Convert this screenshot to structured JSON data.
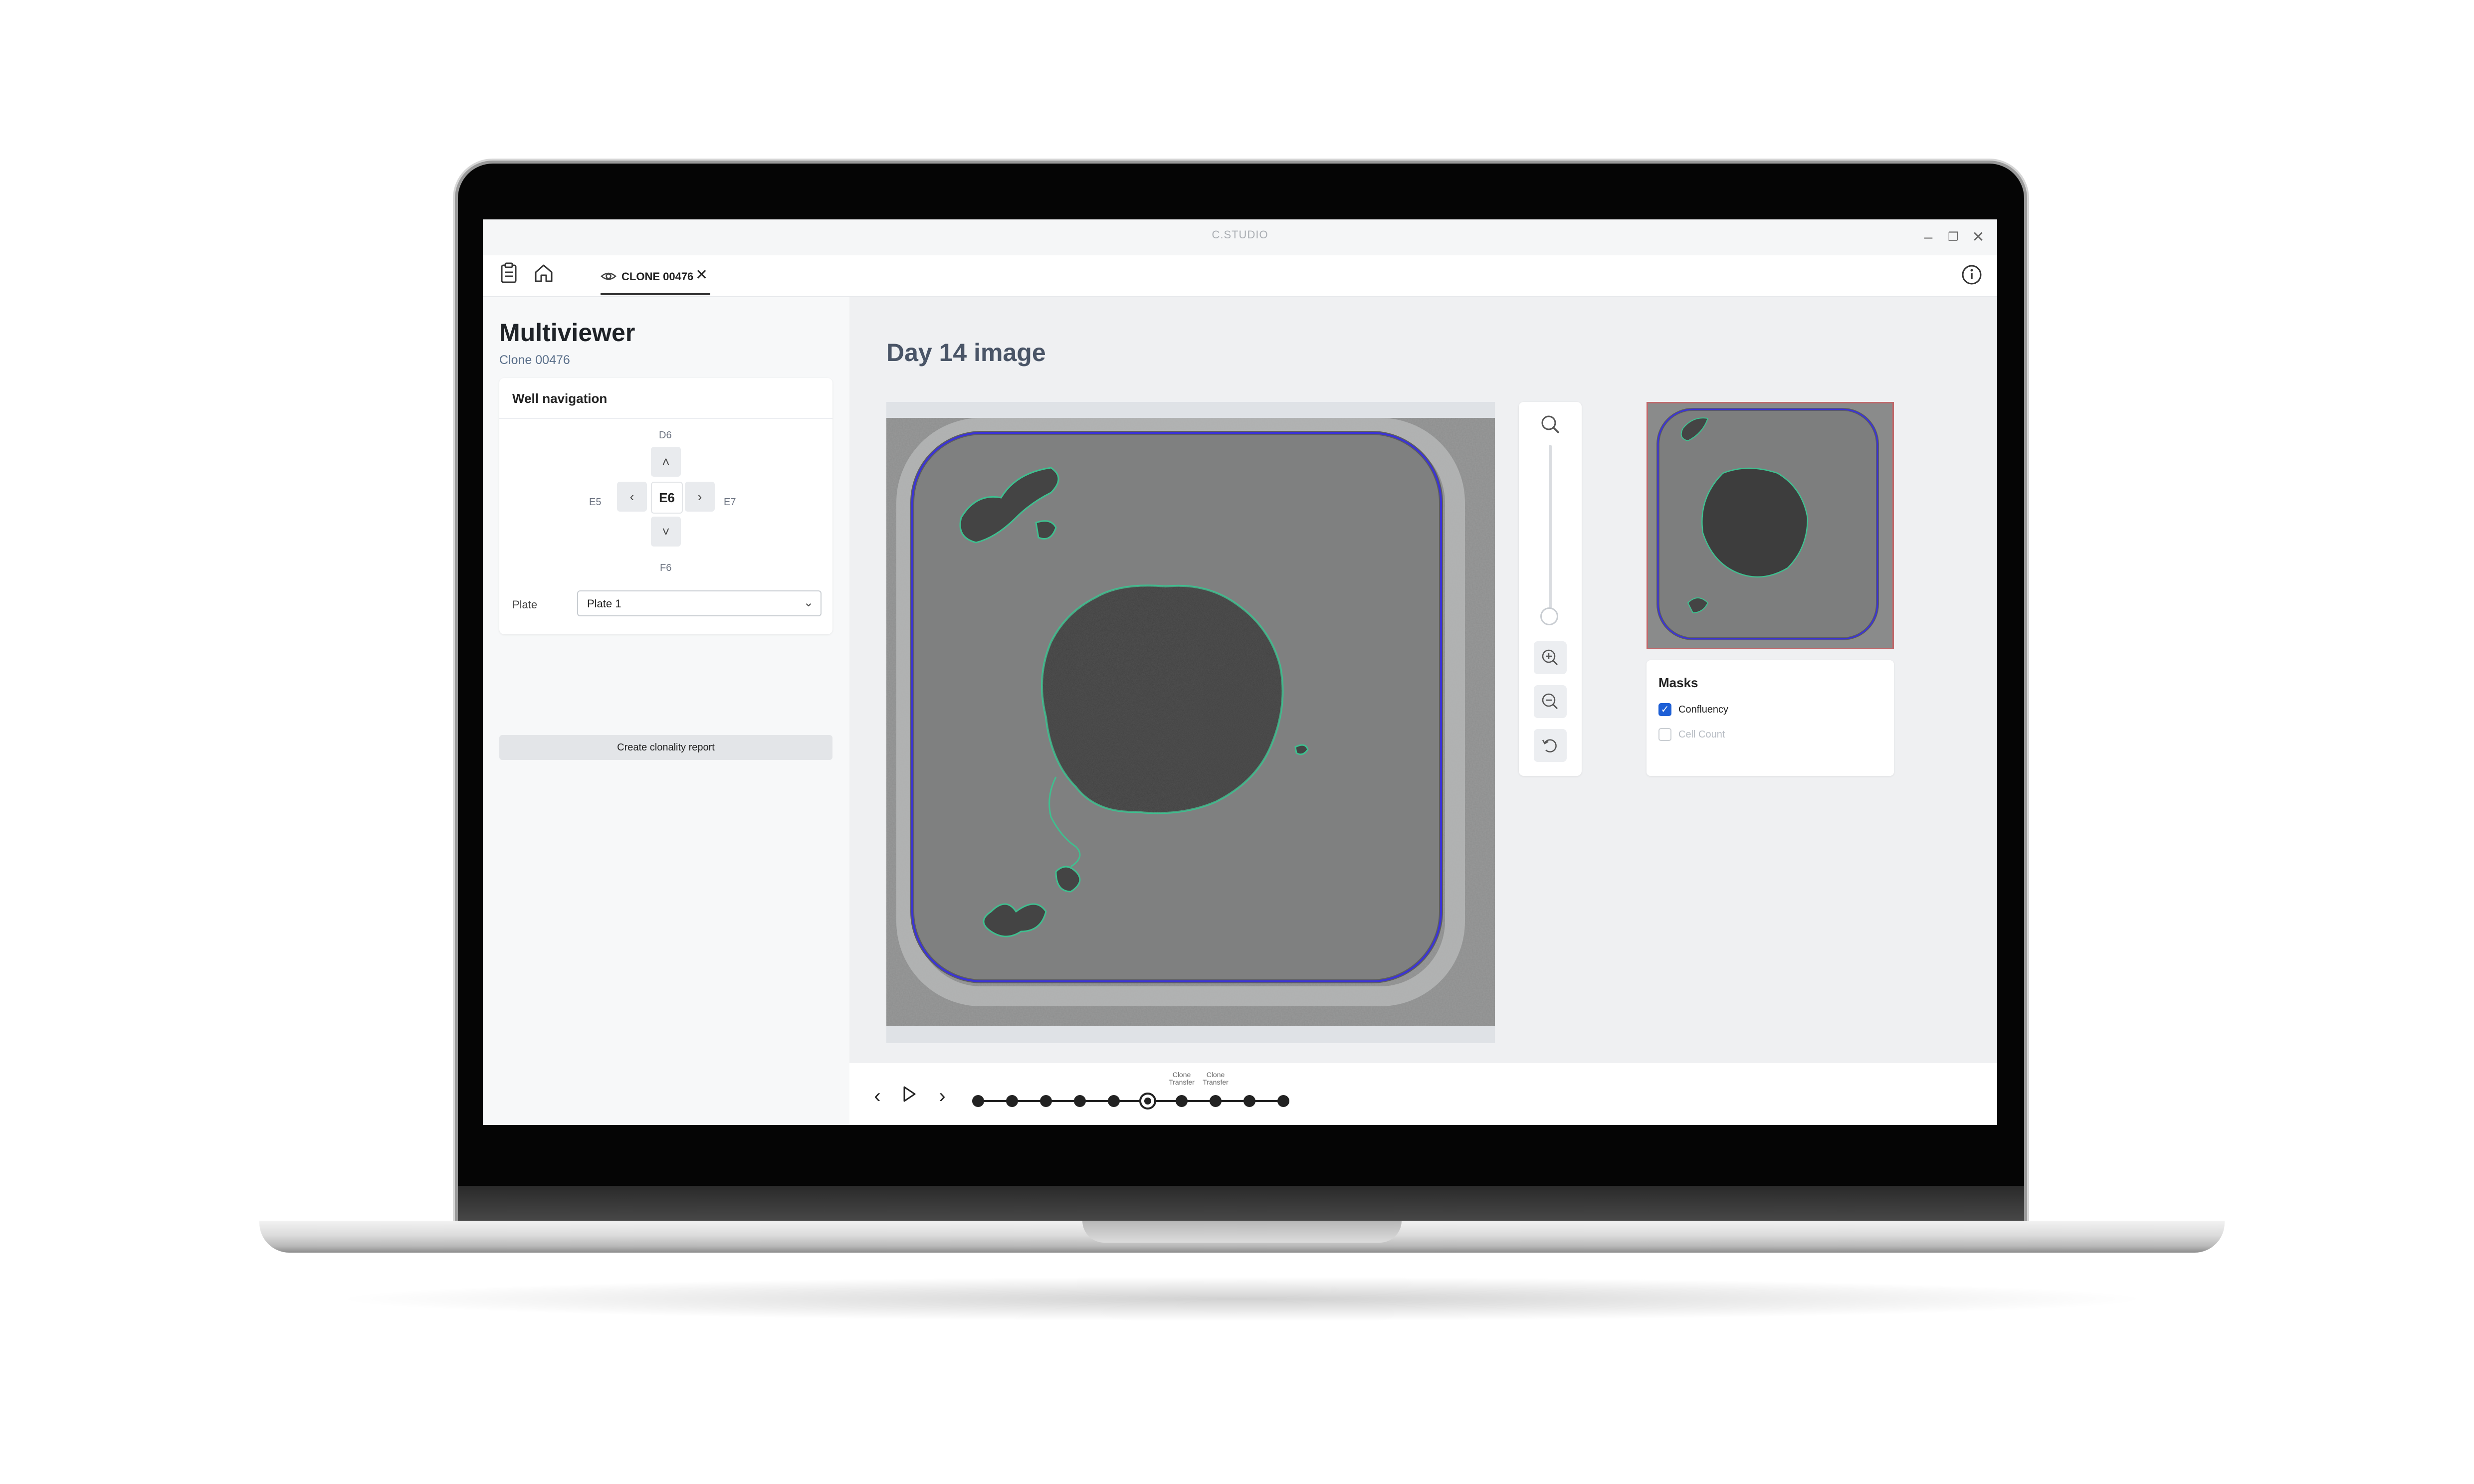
{
  "app": {
    "title": "C.STUDIO"
  },
  "window_controls": [
    "minimize",
    "restore",
    "close"
  ],
  "tabs": {
    "clone_tab_label": "CLONE 00476",
    "icons": [
      "clipboard-icon",
      "home-icon",
      "eye-icon",
      "close-icon",
      "info-icon"
    ]
  },
  "left_panel": {
    "title": "Multiviewer",
    "subtitle": "Clone 00476",
    "well_navigation": {
      "title": "Well navigation",
      "up": "D6",
      "left": "E5",
      "center": "E6",
      "right": "E7",
      "down": "F6"
    },
    "plate": {
      "label": "Plate",
      "value": "Plate 1"
    },
    "report_button": "Create clonality report"
  },
  "main": {
    "title": "Day 14 image",
    "masks": {
      "title": "Masks",
      "items": [
        {
          "label": "Confluency",
          "checked": true
        },
        {
          "label": "Cell Count",
          "checked": false
        }
      ]
    },
    "zoom_level": 0
  },
  "timeline": {
    "points": 10,
    "current_index": 5,
    "annotations": [
      {
        "index": 6,
        "text": "Clone Transfer"
      },
      {
        "index": 7,
        "text": "Clone Transfer"
      }
    ]
  },
  "colors": {
    "accent": "#1d5fd6",
    "confluency_outline": "#3fbf8f",
    "well_outline": "#3b33d6",
    "thumbnail_border": "#c1676a"
  }
}
